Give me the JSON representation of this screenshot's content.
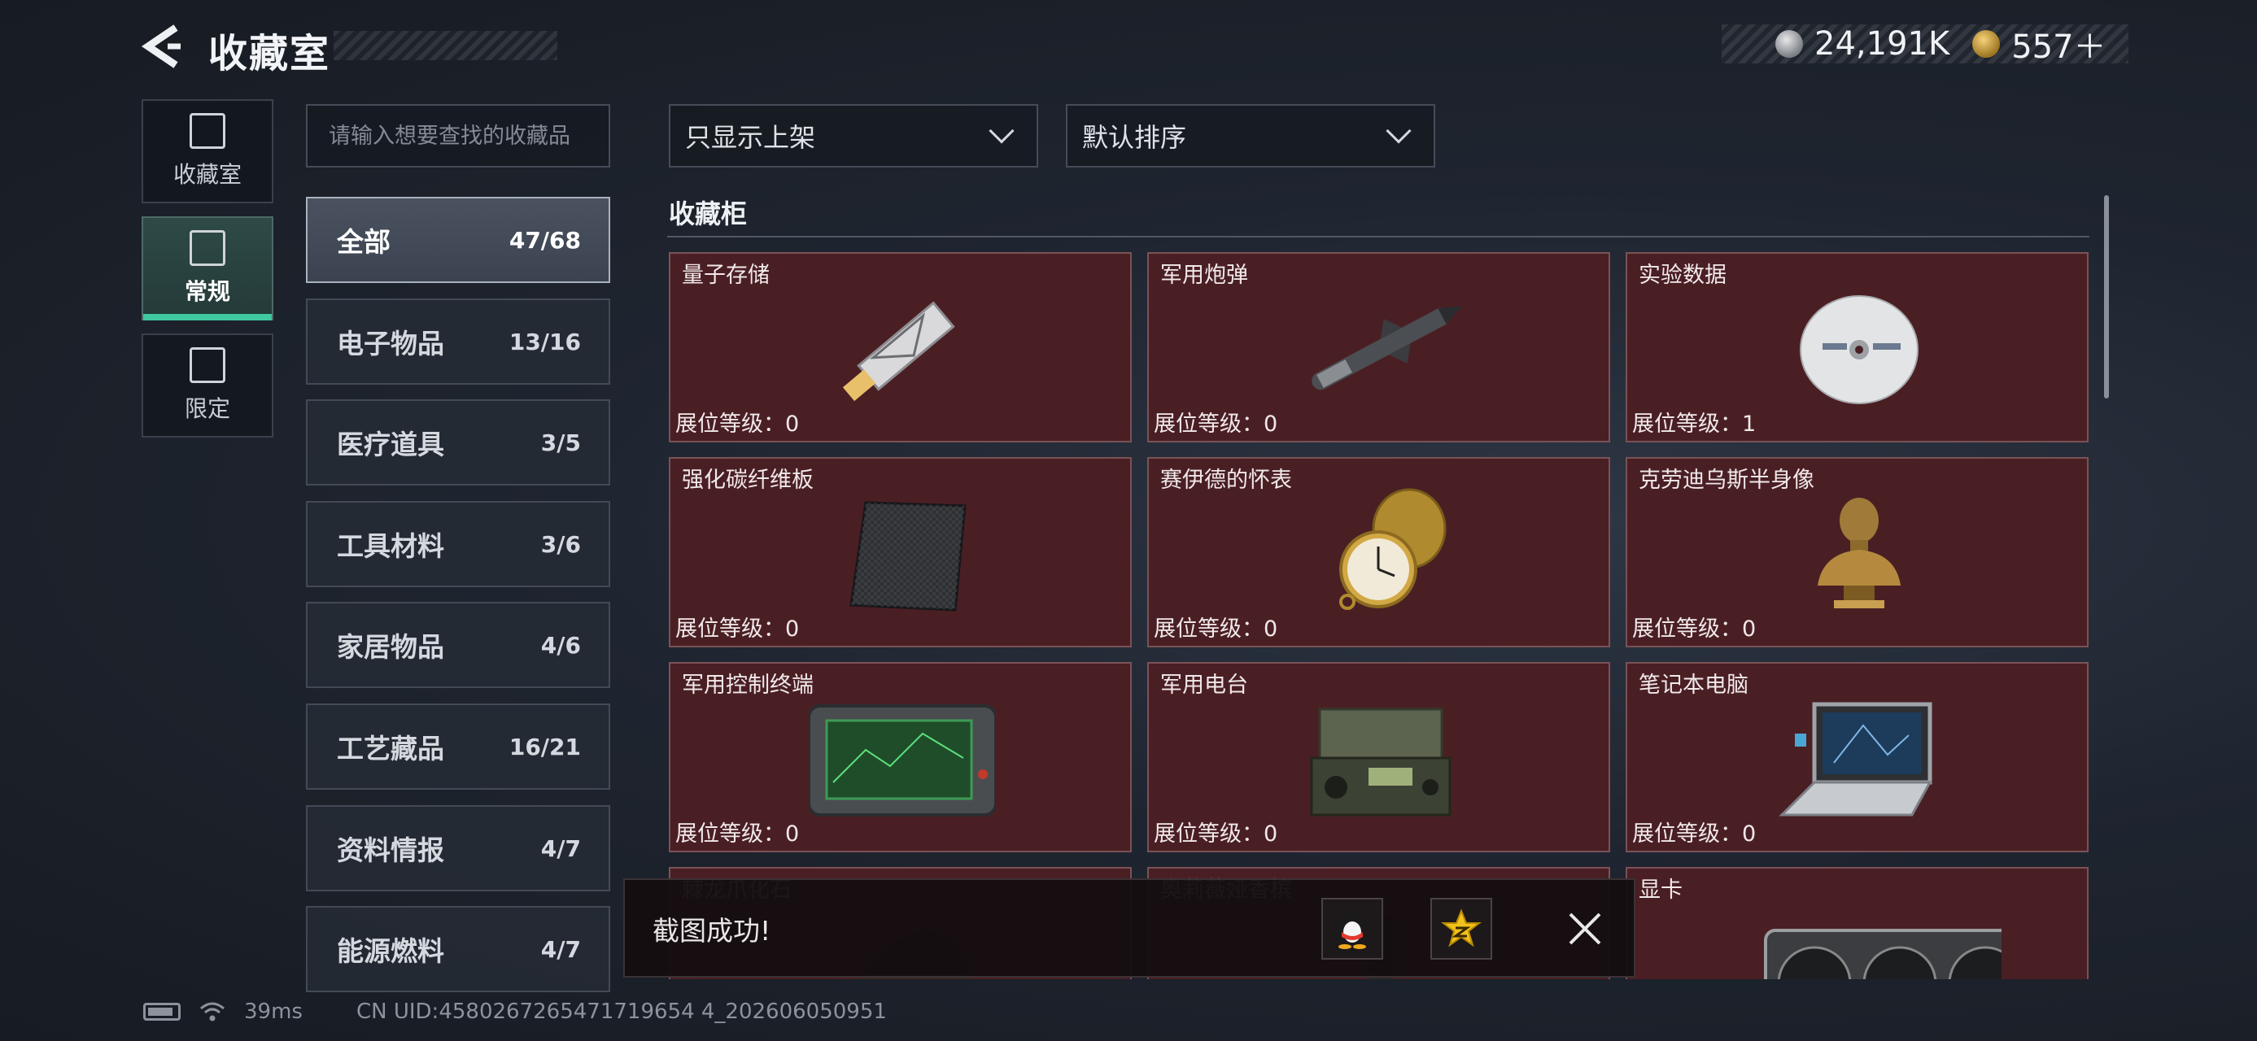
{
  "header": {
    "title": "收藏室"
  },
  "currency": {
    "silver": "24,191K",
    "gold": "557＋"
  },
  "nav": [
    {
      "label": "收藏室",
      "icon": "vault-icon"
    },
    {
      "label": "常规",
      "icon": "document-icon"
    },
    {
      "label": "限定",
      "icon": "limited-icon"
    }
  ],
  "search": {
    "placeholder": "请输入想要查找的收藏品"
  },
  "categories": [
    {
      "name": "全部",
      "count": "47/68"
    },
    {
      "name": "电子物品",
      "count": "13/16"
    },
    {
      "name": "医疗道具",
      "count": "3/5"
    },
    {
      "name": "工具材料",
      "count": "3/6"
    },
    {
      "name": "家居物品",
      "count": "4/6"
    },
    {
      "name": "工艺藏品",
      "count": "16/21"
    },
    {
      "name": "资料情报",
      "count": "4/7"
    },
    {
      "name": "能源燃料",
      "count": "4/7"
    }
  ],
  "filters": {
    "listing": "只显示上架",
    "sort": "默认排序"
  },
  "section": {
    "title": "收藏柜"
  },
  "items": [
    {
      "name": "量子存储",
      "level": "展位等级：0",
      "icon": "usb-drive-icon"
    },
    {
      "name": "军用炮弹",
      "level": "展位等级：0",
      "icon": "missile-icon"
    },
    {
      "name": "实验数据",
      "level": "展位等级：1",
      "icon": "disc-icon"
    },
    {
      "name": "强化碳纤维板",
      "level": "展位等级：0",
      "icon": "carbon-plate-icon"
    },
    {
      "name": "赛伊德的怀表",
      "level": "展位等级：0",
      "icon": "pocket-watch-icon"
    },
    {
      "name": "克劳迪乌斯半身像",
      "level": "展位等级：0",
      "icon": "bust-icon"
    },
    {
      "name": "军用控制终端",
      "level": "展位等级：0",
      "icon": "control-terminal-icon"
    },
    {
      "name": "军用电台",
      "level": "展位等级：0",
      "icon": "radio-icon"
    },
    {
      "name": "笔记本电脑",
      "level": "展位等级：0",
      "icon": "laptop-icon"
    },
    {
      "name": "棘龙爪化石",
      "level": "",
      "icon": "fossil-icon"
    },
    {
      "name": "奥莉薇娅香槟",
      "level": "",
      "icon": "champagne-icon"
    },
    {
      "name": "显卡",
      "level": "",
      "icon": "graphics-card-icon"
    }
  ],
  "toast": {
    "message": "截图成功!"
  },
  "status": {
    "ping": "39ms",
    "uid": "CN UID:4580267265471719654 4_202606050951"
  }
}
